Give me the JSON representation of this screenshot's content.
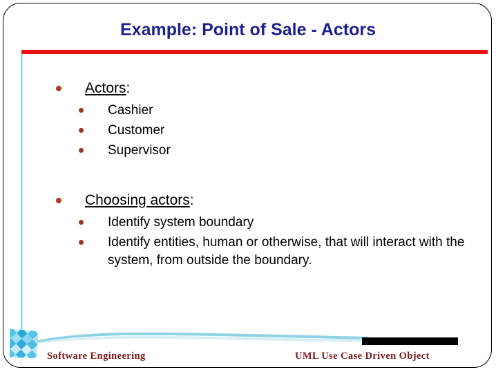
{
  "slide": {
    "title": "Example: Point of Sale - Actors",
    "title_color": "#1f1f8f",
    "accent_rule_color": "#e81414",
    "side_line_color": "#7fd8ee",
    "bullet_level1_color": "#a8411a",
    "bullet_level2_color": "#9e3320",
    "body_text_color": "#000000"
  },
  "sections": [
    {
      "heading": "Actors",
      "heading_suffix": ":",
      "items": [
        "Cashier",
        "Customer",
        "Supervisor"
      ]
    },
    {
      "heading": "Choosing actors",
      "heading_suffix": ":",
      "items": [
        "Identify system boundary",
        "Identify entities, human or otherwise, that will interact with the system, from outside the boundary."
      ]
    }
  ],
  "footer": {
    "left_text": "Software Engineering",
    "right_text": "UML Use Case Driven Object",
    "text_color": "#7b1b1b",
    "bar_color": "#000000",
    "logo_name": "checkerboard-diamond-logo"
  }
}
